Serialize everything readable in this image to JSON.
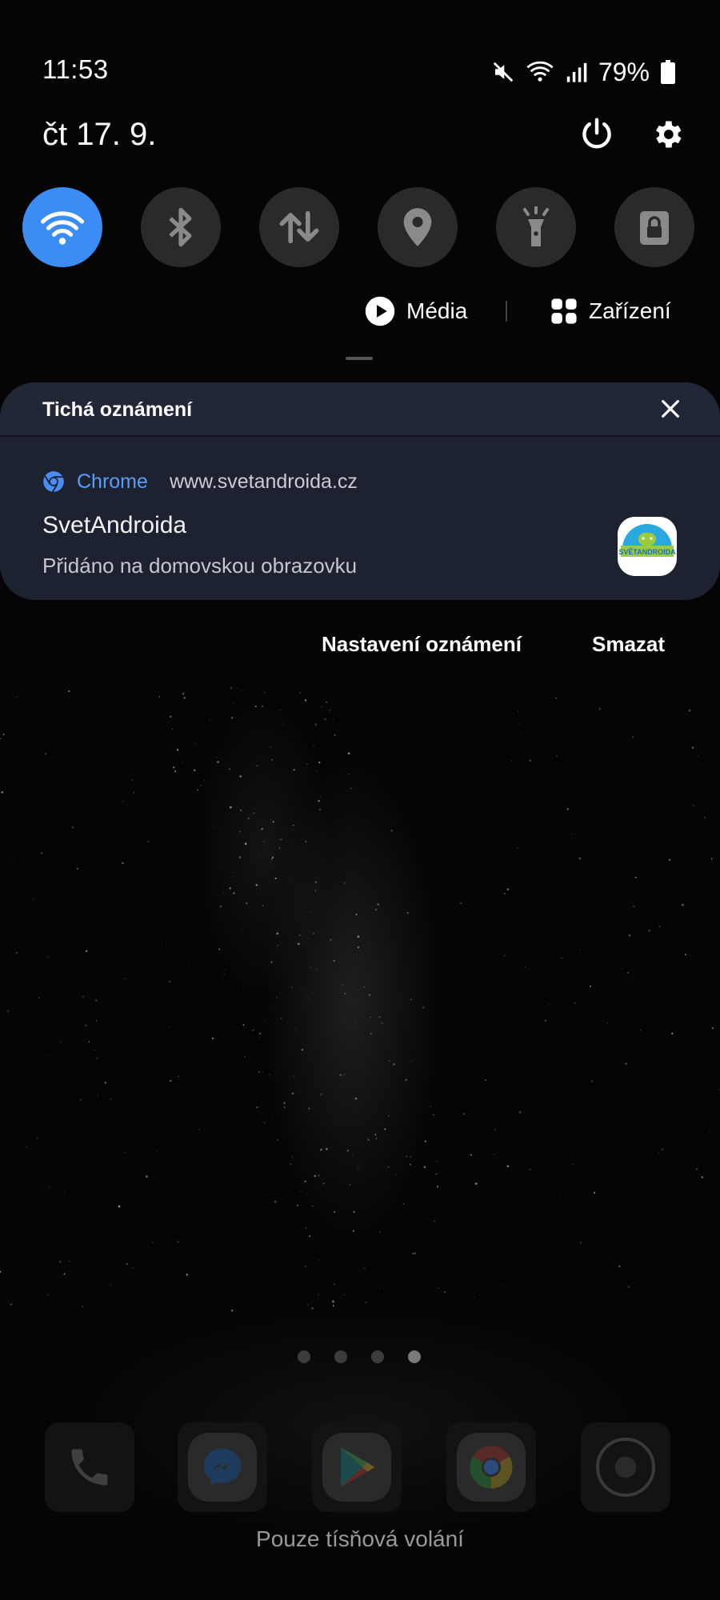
{
  "status_bar": {
    "time": "11:53",
    "battery_percent": "79%",
    "icons": [
      "mute-icon",
      "wifi-icon",
      "signal-icon",
      "battery-icon"
    ]
  },
  "header": {
    "date": "čt 17. 9.",
    "icons": [
      "power-icon",
      "settings-icon"
    ]
  },
  "quick_toggles": [
    {
      "icon": "wifi-icon",
      "active": true
    },
    {
      "icon": "bluetooth-icon",
      "active": false
    },
    {
      "icon": "mobile-data-icon",
      "active": false
    },
    {
      "icon": "location-icon",
      "active": false
    },
    {
      "icon": "flashlight-icon",
      "active": false
    },
    {
      "icon": "secure-folder-icon",
      "active": false
    }
  ],
  "media_row": {
    "media_label": "Média",
    "devices_label": "Zařízení"
  },
  "notifications": {
    "section_title": "Tichá oznámení",
    "items": [
      {
        "app": "Chrome",
        "source": "www.svetandroida.cz",
        "title": "SvetAndroida",
        "text": "Přidáno na domovskou obrazovku",
        "large_icon": "svetandroida-logo",
        "large_icon_text": "SVĚTANDROIDA"
      }
    ],
    "settings_label": "Nastavení oznámení",
    "clear_label": "Smazat"
  },
  "home": {
    "page_count": 4,
    "current_page": 4,
    "dock": [
      "phone-icon",
      "messenger-icon",
      "play-store-icon",
      "chrome-icon",
      "camera-icon"
    ],
    "emergency_text": "Pouze tísňová volání"
  },
  "colors": {
    "accent": "#3b8cf5",
    "link": "#5a9df8",
    "panel": "#1c2230",
    "toggle_off": "#2a2a2a"
  }
}
